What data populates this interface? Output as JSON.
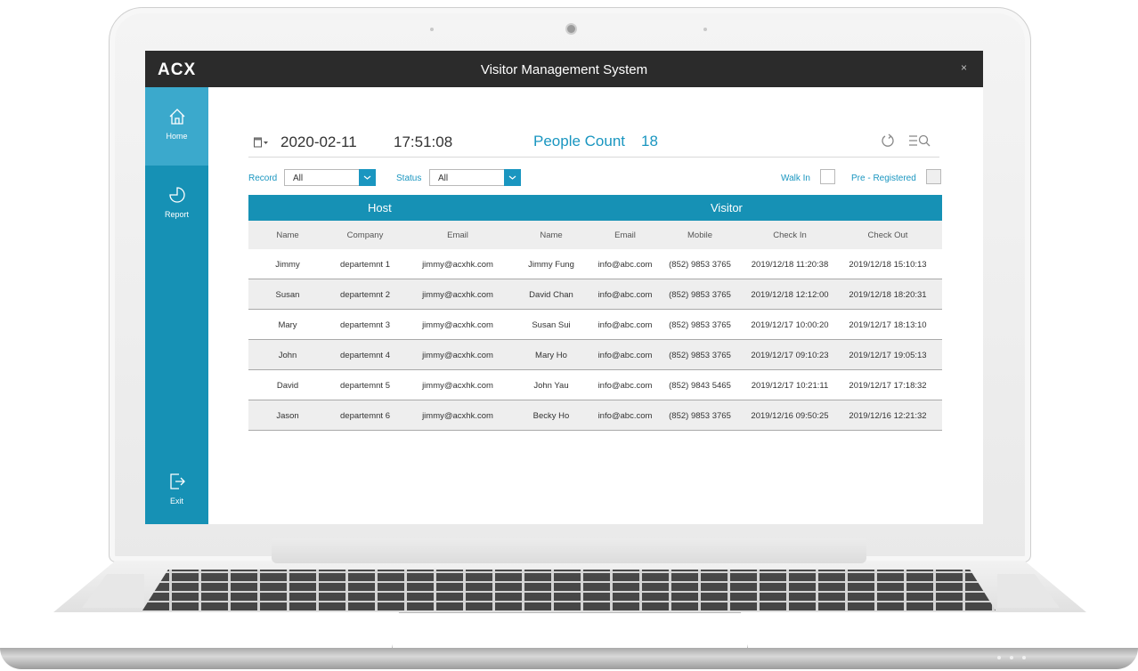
{
  "app": {
    "logo": "ACX",
    "title": "Visitor Management System",
    "close_label": "×"
  },
  "sidebar": {
    "items": [
      {
        "label": "Home",
        "icon": "home-icon",
        "active": true
      },
      {
        "label": "Report",
        "icon": "pie-chart-icon",
        "active": false
      },
      {
        "label": "Exit",
        "icon": "exit-icon",
        "active": false
      }
    ]
  },
  "toolbar": {
    "date": "2020-02-11",
    "time": "17:51:08",
    "people_count_label": "People Count",
    "people_count": "18"
  },
  "filters": {
    "record_label": "Record",
    "record_value": "All",
    "status_label": "Status",
    "status_value": "All",
    "walk_in_label": "Walk In",
    "pre_registered_label": "Pre - Registered"
  },
  "table": {
    "groups": [
      "Host",
      "Visitor"
    ],
    "columns": [
      "Name",
      "Company",
      "Email",
      "Name",
      "Email",
      "Mobile",
      "Check In",
      "Check Out"
    ],
    "rows": [
      [
        "Jimmy",
        "departemnt 1",
        "jimmy@acxhk.com",
        "Jimmy Fung",
        "info@abc.com",
        "(852) 9853 3765",
        "2019/12/18 11:20:38",
        "2019/12/18 15:10:13"
      ],
      [
        "Susan",
        "departemnt 2",
        "jimmy@acxhk.com",
        "David Chan",
        "info@abc.com",
        "(852) 9853 3765",
        "2019/12/18 12:12:00",
        "2019/12/18 18:20:31"
      ],
      [
        "Mary",
        "departemnt 3",
        "jimmy@acxhk.com",
        "Susan Sui",
        "info@abc.com",
        "(852) 9853 3765",
        "2019/12/17 10:00:20",
        "2019/12/17 18:13:10"
      ],
      [
        "John",
        "departemnt 4",
        "jimmy@acxhk.com",
        "Mary Ho",
        "info@abc.com",
        "(852) 9853 3765",
        "2019/12/17 09:10:23",
        "2019/12/17 19:05:13"
      ],
      [
        "David",
        "departemnt 5",
        "jimmy@acxhk.com",
        "John Yau",
        "info@abc.com",
        "(852) 9843 5465",
        "2019/12/17 10:21:11",
        "2019/12/17 17:18:32"
      ],
      [
        "Jason",
        "departemnt 6",
        "jimmy@acxhk.com",
        "Becky Ho",
        "info@abc.com",
        "(852) 9853 3765",
        "2019/12/16 09:50:25",
        "2019/12/16 12:21:32"
      ]
    ]
  },
  "colors": {
    "accent": "#1691b5",
    "sidebar_active": "#3ba9cc",
    "titlebar": "#2b2b2b",
    "row_alt": "#eeeeee"
  }
}
